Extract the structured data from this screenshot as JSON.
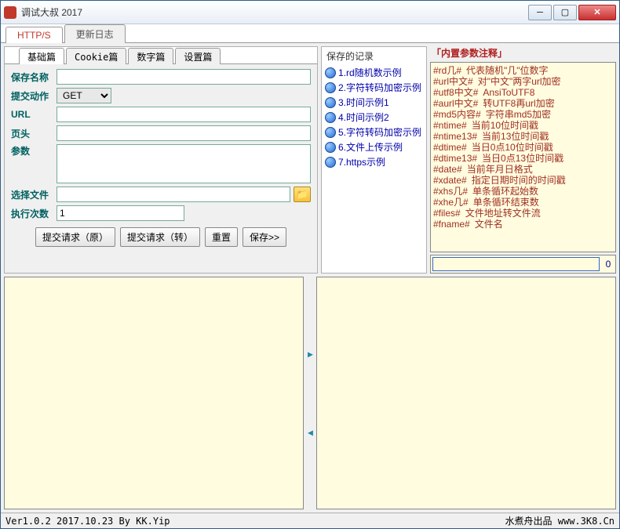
{
  "window": {
    "title": "调试大叔 2017"
  },
  "maintabs": [
    {
      "label": "HTTP/S",
      "active": true
    },
    {
      "label": "更新日志",
      "active": false
    }
  ],
  "subtabs": [
    {
      "label": "基础篇",
      "active": true
    },
    {
      "label": "Cookie篇",
      "active": false
    },
    {
      "label": "数字篇",
      "active": false
    },
    {
      "label": "设置篇",
      "active": false
    }
  ],
  "form": {
    "save_name_label": "保存名称",
    "save_name_value": "",
    "action_label": "提交动作",
    "action_value": "GET",
    "url_label": "URL",
    "url_value": "",
    "header_label": "页头",
    "header_value": "",
    "params_label": "参数",
    "params_value": "",
    "file_label": "选择文件",
    "file_value": "",
    "count_label": "执行次数",
    "count_value": "1"
  },
  "buttons": {
    "submit_raw": "提交请求（原）",
    "submit_conv": "提交请求（转）",
    "reset": "重置",
    "save": "保存>>"
  },
  "records": {
    "header": "保存的记录",
    "items": [
      "1.rd随机数示例",
      "2.字符转码加密示例",
      "3.时间示例1",
      "4.时间示例2",
      "5.字符转码加密示例",
      "6.文件上传示例",
      "7.https示例"
    ]
  },
  "paramref": {
    "title": "「内置参数注释」",
    "lines": [
      {
        "k": "#rd几#",
        "d": "代表随机\"几\"位数字"
      },
      {
        "k": "#url中文#",
        "d": "对\"中文\"两字url加密"
      },
      {
        "k": "#utf8中文#",
        "d": "AnsiToUTF8"
      },
      {
        "k": "#aurl中文#",
        "d": "转UTF8再url加密"
      },
      {
        "k": "#md5内容#",
        "d": "字符串md5加密"
      },
      {
        "k": "#ntime#",
        "d": "当前10位时间戳"
      },
      {
        "k": "#ntime13#",
        "d": "当前13位时间戳"
      },
      {
        "k": "#dtime#",
        "d": "当日0点10位时间戳"
      },
      {
        "k": "#dtime13#",
        "d": "当日0点13位时间戳"
      },
      {
        "k": "#date#",
        "d": "当前年月日格式"
      },
      {
        "k": "#xdate#",
        "d": "指定日期时间的时间戳"
      },
      {
        "k": "#xhs几#",
        "d": "单条循环起始数"
      },
      {
        "k": "#xhe几#",
        "d": "单条循环结束数"
      },
      {
        "k": "#files#",
        "d": "文件地址转文件流"
      },
      {
        "k": "#fname#",
        "d": "文件名"
      }
    ]
  },
  "search": {
    "value": "",
    "count": "0"
  },
  "status": {
    "left": "Ver1.0.2 2017.10.23 By KK.Yip",
    "right": "水煮舟出品 www.3K8.Cn"
  }
}
